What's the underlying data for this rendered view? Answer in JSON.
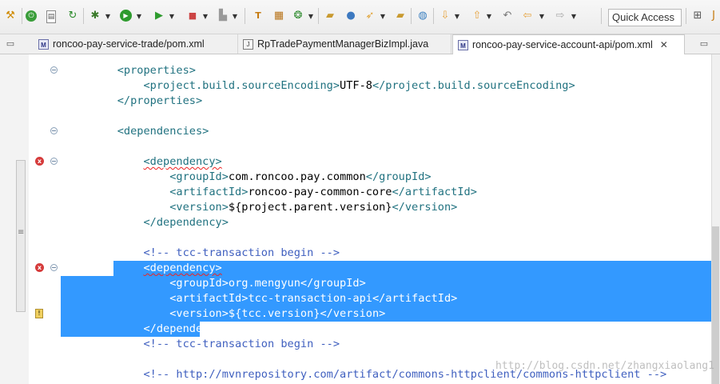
{
  "toolbar": {
    "icons": [
      "debug-tool-icon",
      "power-icon",
      "new-file-icon",
      "refresh-error-icon",
      "bug-icon",
      "run-icon",
      "run-external-icon",
      "stop-icon",
      "launch-config-icon",
      "open-type-icon",
      "package-icon",
      "ant-icon",
      "open-folder-icon",
      "team-icon",
      "deploy-icon",
      "open-task-icon",
      "globe-icon",
      "next-annotation-icon",
      "previous-annotation-icon",
      "back-icon",
      "forward-icon"
    ],
    "quick_access_placeholder": "Quick Access"
  },
  "tabs": [
    {
      "label": "roncoo-pay-service-trade/pom.xml",
      "icon": "maven-pom-icon",
      "active": false
    },
    {
      "label": "RpTradePaymentManagerBizImpl.java",
      "icon": "java-file-icon",
      "active": false
    },
    {
      "label": "roncoo-pay-service-account-api/pom.xml",
      "icon": "maven-pom-icon",
      "active": true
    }
  ],
  "tab_close_glyph": "✕",
  "editor": {
    "lines": [
      {
        "indent": "    ",
        "parts": [
          {
            "c": "tag",
            "t": "<properties>"
          }
        ]
      },
      {
        "indent": "        ",
        "parts": [
          {
            "c": "tag",
            "t": "<project.build.sourceEncoding>"
          },
          {
            "c": "txt",
            "t": "UTF-8"
          },
          {
            "c": "tag",
            "t": "</project.build.sourceEncoding>"
          }
        ]
      },
      {
        "indent": "    ",
        "parts": [
          {
            "c": "tag",
            "t": "</properties>"
          }
        ]
      },
      {
        "indent": "",
        "parts": []
      },
      {
        "indent": "    ",
        "parts": [
          {
            "c": "tag",
            "t": "<dependencies>"
          }
        ]
      },
      {
        "indent": "",
        "parts": []
      },
      {
        "indent": "        ",
        "parts": [
          {
            "c": "tag",
            "t": "<dependency>",
            "sq": true
          }
        ]
      },
      {
        "indent": "            ",
        "parts": [
          {
            "c": "tag",
            "t": "<groupId>"
          },
          {
            "c": "txt",
            "t": "com.roncoo.pay.common"
          },
          {
            "c": "tag",
            "t": "</groupId>"
          }
        ]
      },
      {
        "indent": "            ",
        "parts": [
          {
            "c": "tag",
            "t": "<artifactId>"
          },
          {
            "c": "txt",
            "t": "roncoo-pay-common-core"
          },
          {
            "c": "tag",
            "t": "</artifactId>"
          }
        ]
      },
      {
        "indent": "            ",
        "parts": [
          {
            "c": "tag",
            "t": "<version>"
          },
          {
            "c": "txt",
            "t": "${project.parent.version}"
          },
          {
            "c": "tag",
            "t": "</version>"
          }
        ]
      },
      {
        "indent": "        ",
        "parts": [
          {
            "c": "tag",
            "t": "</dependency>"
          }
        ]
      },
      {
        "indent": "",
        "parts": []
      },
      {
        "indent": "        ",
        "parts": [
          {
            "c": "cmt",
            "t": "<!-- tcc-transaction begin -->"
          }
        ]
      },
      {
        "indent": "        ",
        "parts": [
          {
            "c": "tag",
            "t": "<dependency>",
            "sq": true
          }
        ],
        "selected": true
      },
      {
        "indent": "            ",
        "parts": [
          {
            "c": "tag",
            "t": "<groupId>"
          },
          {
            "c": "txt",
            "t": "org.mengyun"
          },
          {
            "c": "tag",
            "t": "</groupId>"
          }
        ],
        "selected": true
      },
      {
        "indent": "            ",
        "parts": [
          {
            "c": "tag",
            "t": "<artifactId>"
          },
          {
            "c": "txt",
            "t": "tcc-transaction-api"
          },
          {
            "c": "tag",
            "t": "</artifactId>"
          }
        ],
        "selected": true
      },
      {
        "indent": "            ",
        "parts": [
          {
            "c": "tag",
            "t": "<version>"
          },
          {
            "c": "txt",
            "t": "${tcc.version}"
          },
          {
            "c": "tag",
            "t": "</version>"
          }
        ],
        "selected": true
      },
      {
        "indent": "        ",
        "parts": [
          {
            "c": "tag",
            "t": "</dependency>"
          }
        ],
        "selected": true
      },
      {
        "indent": "        ",
        "parts": [
          {
            "c": "cmt",
            "t": "<!-- tcc-transaction begin -->"
          }
        ]
      },
      {
        "indent": "",
        "parts": []
      },
      {
        "indent": "        ",
        "parts": [
          {
            "c": "cmt",
            "t": "<!-- http://mvnrepository.com/artifact/commons-httpclient/commons-httpclient -->"
          }
        ]
      }
    ]
  },
  "watermark": "http://blog.csdn.net/zhangxiaolang1"
}
